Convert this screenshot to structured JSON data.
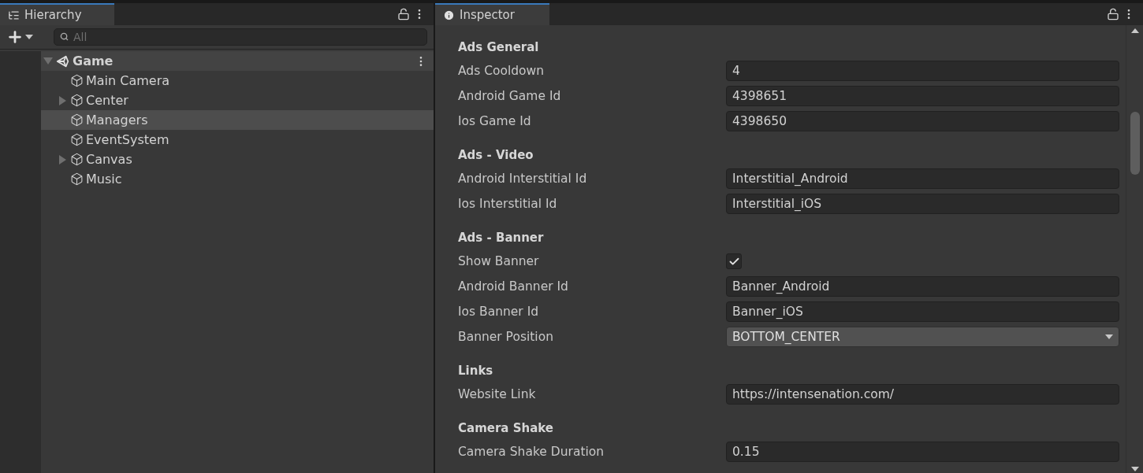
{
  "hierarchy": {
    "tab": {
      "label": "Hierarchy",
      "selected": true
    },
    "search": {
      "placeholder": "All"
    },
    "items": [
      {
        "name": "Game",
        "kind": "scene",
        "expanded": true,
        "children": [
          {
            "name": "Main Camera",
            "kind": "object",
            "selected": false
          },
          {
            "name": "Center",
            "kind": "object",
            "expanded": false,
            "selected": false
          },
          {
            "name": "Managers",
            "kind": "object",
            "selected": true
          },
          {
            "name": "EventSystem",
            "kind": "object",
            "selected": false
          },
          {
            "name": "Canvas",
            "kind": "object",
            "expanded": false,
            "selected": false
          },
          {
            "name": "Music",
            "kind": "object",
            "selected": false
          }
        ]
      }
    ]
  },
  "inspector": {
    "tab": {
      "label": "Inspector",
      "selected": true
    },
    "sections": [
      {
        "title": "Ads General",
        "fields": [
          {
            "label": "Ads Cooldown",
            "kind": "text",
            "value": "4"
          },
          {
            "label": "Android Game Id",
            "kind": "text",
            "value": "4398651"
          },
          {
            "label": "Ios Game Id",
            "kind": "text",
            "value": "4398650"
          }
        ]
      },
      {
        "title": "Ads - Video",
        "fields": [
          {
            "label": "Android Interstitial Id",
            "kind": "text",
            "value": "Interstitial_Android"
          },
          {
            "label": "Ios Interstitial Id",
            "kind": "text",
            "value": "Interstitial_iOS"
          }
        ]
      },
      {
        "title": "Ads - Banner",
        "fields": [
          {
            "label": "Show Banner",
            "kind": "checkbox",
            "checked": true
          },
          {
            "label": "Android Banner Id",
            "kind": "text",
            "value": "Banner_Android"
          },
          {
            "label": "Ios Banner Id",
            "kind": "text",
            "value": "Banner_iOS"
          },
          {
            "label": "Banner Position",
            "kind": "dropdown",
            "value": "BOTTOM_CENTER"
          }
        ]
      },
      {
        "title": "Links",
        "fields": [
          {
            "label": "Website Link",
            "kind": "text",
            "value": "https://intensenation.com/"
          }
        ]
      },
      {
        "title": "Camera Shake",
        "fields": [
          {
            "label": "Camera Shake Duration",
            "kind": "text",
            "value": "0.15"
          }
        ]
      }
    ]
  }
}
